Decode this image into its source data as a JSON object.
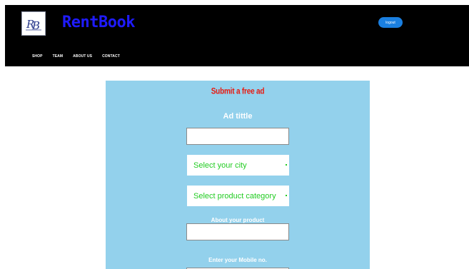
{
  "header": {
    "brand": "RentBook",
    "logo_text": "RB",
    "logout_label": "logout",
    "nav": [
      "SHOP",
      "TEAM",
      "ABOUT US",
      "CONTACT"
    ]
  },
  "form": {
    "heading": "Submit a free ad",
    "ad_title_label": "Ad tittle",
    "ad_title_value": "",
    "city_select": "Select your city",
    "category_select": "Select product category",
    "about_label": "About your product",
    "about_value": "",
    "mobile_label": "Enter your Mobile no.",
    "mobile_value": ""
  },
  "colors": {
    "header_bg": "#000000",
    "brand": "#1f1bff",
    "panel_bg": "#93d1ec",
    "heading": "#e8190f",
    "select_text": "#22cc22",
    "button_bg": "#1a7fe0"
  }
}
